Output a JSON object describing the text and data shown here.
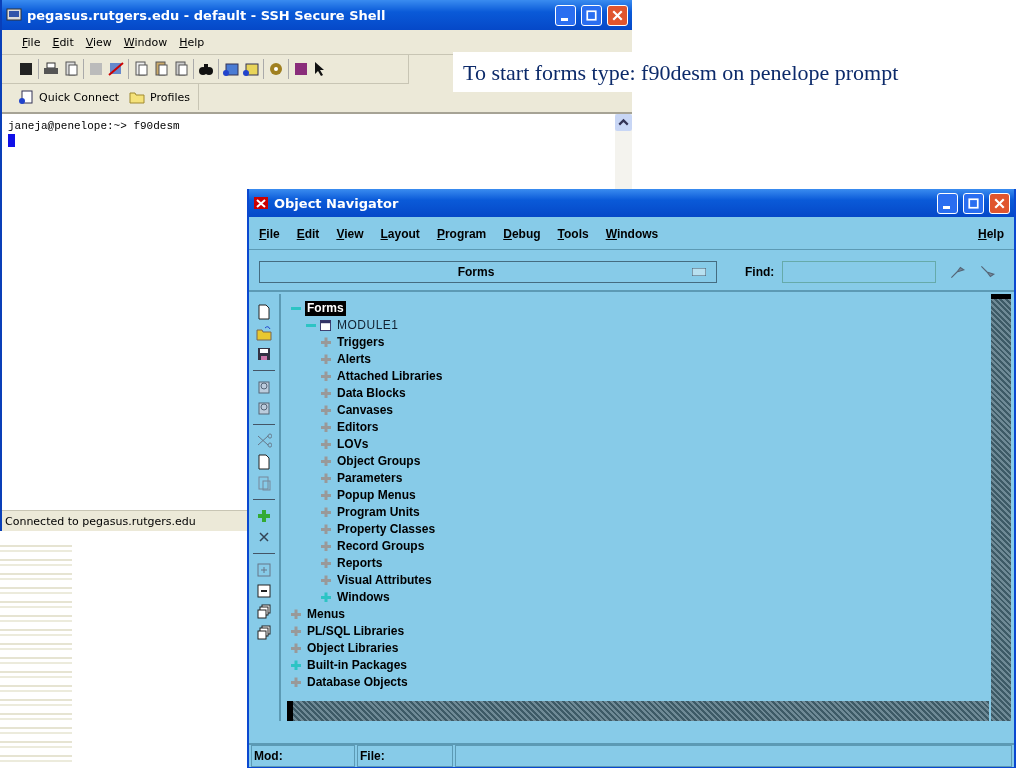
{
  "ssh": {
    "title": "pegasus.rutgers.edu - default - SSH Secure Shell",
    "menu": [
      "File",
      "Edit",
      "View",
      "Window",
      "Help"
    ],
    "quick_connect": "Quick Connect",
    "profiles": "Profiles",
    "terminal_lines": [
      "janeja@penelope:~> f90desm"
    ],
    "status": "Connected to pegasus.rutgers.edu"
  },
  "caption": "To start forms type: f90desm on penelope prompt",
  "navigator": {
    "title": "Object Navigator",
    "menu": [
      "File",
      "Edit",
      "View",
      "Layout",
      "Program",
      "Debug",
      "Tools",
      "Windows"
    ],
    "help": "Help",
    "dropdown": "Forms",
    "find_label": "Find:",
    "tree": [
      {
        "label": "Forms",
        "kind": "category",
        "selected": true,
        "expanded": true,
        "populated": true,
        "children": [
          {
            "label": "MODULE1",
            "kind": "module",
            "selected": false,
            "expanded": true,
            "populated": true,
            "children": [
              {
                "label": "Triggers",
                "kind": "category",
                "selected": false,
                "expanded": false,
                "populated": false
              },
              {
                "label": "Alerts",
                "kind": "category",
                "selected": false,
                "expanded": false,
                "populated": false
              },
              {
                "label": "Attached Libraries",
                "kind": "category",
                "selected": false,
                "expanded": false,
                "populated": false
              },
              {
                "label": "Data Blocks",
                "kind": "category",
                "selected": false,
                "expanded": false,
                "populated": false
              },
              {
                "label": "Canvases",
                "kind": "category",
                "selected": false,
                "expanded": false,
                "populated": false
              },
              {
                "label": "Editors",
                "kind": "category",
                "selected": false,
                "expanded": false,
                "populated": false
              },
              {
                "label": "LOVs",
                "kind": "category",
                "selected": false,
                "expanded": false,
                "populated": false
              },
              {
                "label": "Object Groups",
                "kind": "category",
                "selected": false,
                "expanded": false,
                "populated": false
              },
              {
                "label": "Parameters",
                "kind": "category",
                "selected": false,
                "expanded": false,
                "populated": false
              },
              {
                "label": "Popup Menus",
                "kind": "category",
                "selected": false,
                "expanded": false,
                "populated": false
              },
              {
                "label": "Program Units",
                "kind": "category",
                "selected": false,
                "expanded": false,
                "populated": false
              },
              {
                "label": "Property Classes",
                "kind": "category",
                "selected": false,
                "expanded": false,
                "populated": false
              },
              {
                "label": "Record Groups",
                "kind": "category",
                "selected": false,
                "expanded": false,
                "populated": false
              },
              {
                "label": "Reports",
                "kind": "category",
                "selected": false,
                "expanded": false,
                "populated": false
              },
              {
                "label": "Visual Attributes",
                "kind": "category",
                "selected": false,
                "expanded": false,
                "populated": false
              },
              {
                "label": "Windows",
                "kind": "category",
                "selected": false,
                "expanded": false,
                "populated": true
              }
            ]
          }
        ]
      },
      {
        "label": "Menus",
        "kind": "category",
        "selected": false,
        "expanded": false,
        "populated": false
      },
      {
        "label": "PL/SQL Libraries",
        "kind": "category",
        "selected": false,
        "expanded": false,
        "populated": false
      },
      {
        "label": "Object Libraries",
        "kind": "category",
        "selected": false,
        "expanded": false,
        "populated": false
      },
      {
        "label": "Built-in Packages",
        "kind": "category",
        "selected": false,
        "expanded": false,
        "populated": true
      },
      {
        "label": "Database Objects",
        "kind": "category",
        "selected": false,
        "expanded": false,
        "populated": false
      }
    ],
    "status": {
      "mod_label": "Mod:",
      "file_label": "File:"
    }
  }
}
